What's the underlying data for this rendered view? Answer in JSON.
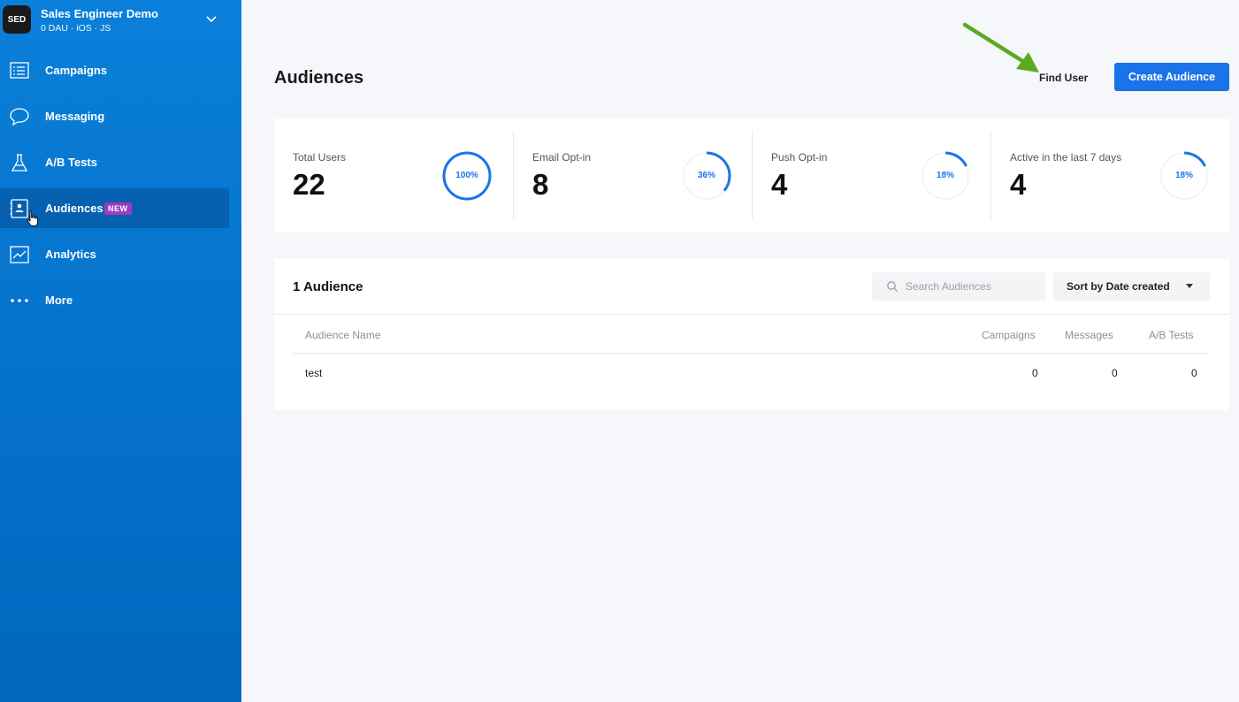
{
  "app": {
    "avatar_initials": "SED",
    "name": "Sales Engineer Demo",
    "meta": "0 DAU · iOS · JS"
  },
  "sidebar": {
    "items": [
      {
        "label": "Campaigns",
        "icon": "list-icon"
      },
      {
        "label": "Messaging",
        "icon": "chat-bubble-icon"
      },
      {
        "label": "A/B Tests",
        "icon": "flask-icon"
      },
      {
        "label": "Audiences",
        "icon": "contact-card-icon",
        "badge": "NEW",
        "active": true
      },
      {
        "label": "Analytics",
        "icon": "line-chart-icon"
      },
      {
        "label": "More",
        "icon": "more-dots-icon"
      }
    ]
  },
  "header": {
    "title": "Audiences",
    "find_user_label": "Find User",
    "create_label": "Create Audience"
  },
  "stats": [
    {
      "label": "Total Users",
      "value": "22",
      "percent_label": "100%",
      "percent": 100
    },
    {
      "label": "Email Opt-in",
      "value": "8",
      "percent_label": "36%",
      "percent": 36
    },
    {
      "label": "Push Opt-in",
      "value": "4",
      "percent_label": "18%",
      "percent": 18
    },
    {
      "label": "Active in the last 7 days",
      "value": "4",
      "percent_label": "18%",
      "percent": 18
    }
  ],
  "list": {
    "title": "1 Audience",
    "search_placeholder": "Search Audiences",
    "sort_label": "Sort by Date created",
    "columns": [
      "Audience Name",
      "Campaigns",
      "Messages",
      "A/B Tests"
    ],
    "rows": [
      {
        "name": "test",
        "campaigns": "0",
        "messages": "0",
        "ab_tests": "0"
      }
    ]
  },
  "colors": {
    "sidebar_top": "#0a7fd9",
    "sidebar_bottom": "#0067be",
    "accent": "#1a73e8",
    "badge": "#9b3dbd",
    "annotation_arrow": "#5aaa1f"
  }
}
